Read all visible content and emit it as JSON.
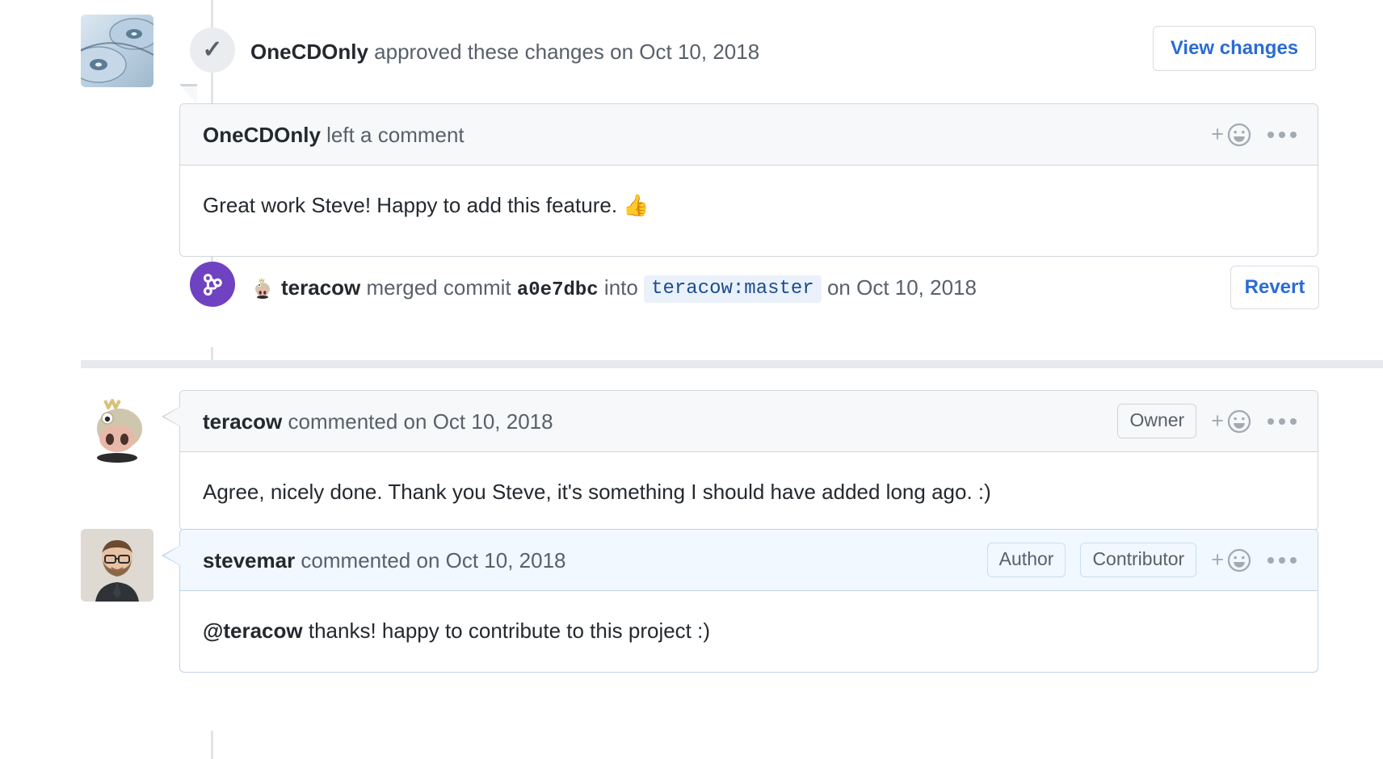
{
  "timeline": {
    "approval_event": {
      "icon": "check-icon",
      "author": "OneCDOnly",
      "action": " approved these changes on ",
      "date": "Oct 10, 2018",
      "button_label": "View changes",
      "avatar_name": "onecdonly-avatar"
    },
    "review_comment": {
      "author": "OneCDOnly",
      "action": " left a comment",
      "body": "Great work Steve! Happy to add this feature. 👍",
      "reaction_icon": "smiley-plus-icon",
      "menu_icon": "kebab-menu-icon"
    },
    "merge_event": {
      "icon": "git-merge-icon",
      "author": "teracow",
      "action_before": " merged commit ",
      "commit_hash": "a0e7dbc",
      "action_mid": " into ",
      "branch": "teracow:master",
      "action_after": " on ",
      "date": "Oct 10, 2018",
      "button_label": "Revert",
      "avatar_name": "teracow-inline-avatar"
    },
    "comments": [
      {
        "author": "teracow",
        "action": " commented on ",
        "date": "Oct 10, 2018",
        "badges": [
          "Owner"
        ],
        "body": "Agree, nicely done. Thank you Steve, it's something I should have added long ago. :)",
        "avatar_name": "teracow-avatar",
        "highlighted": false,
        "reaction_icon": "smiley-plus-icon",
        "menu_icon": "kebab-menu-icon"
      },
      {
        "author": "stevemar",
        "action": " commented on ",
        "date": "Oct 10, 2018",
        "badges": [
          "Author",
          "Contributor"
        ],
        "body_mention": "@teracow",
        "body_rest": " thanks! happy to contribute to this project :)",
        "avatar_name": "stevemar-avatar",
        "highlighted": true,
        "reaction_icon": "smiley-plus-icon",
        "menu_icon": "kebab-menu-icon"
      }
    ]
  },
  "colors": {
    "link_blue": "#2b6cd4",
    "merge_purple": "#6f42c1",
    "rail_gray": "#e1e4e8",
    "header_gray": "#f6f8fa",
    "header_blue": "#f1f8ff",
    "border_gray": "#d1d5da",
    "border_blue": "#c0d3eb",
    "text_dark": "#24292e",
    "text_muted": "#586069"
  }
}
